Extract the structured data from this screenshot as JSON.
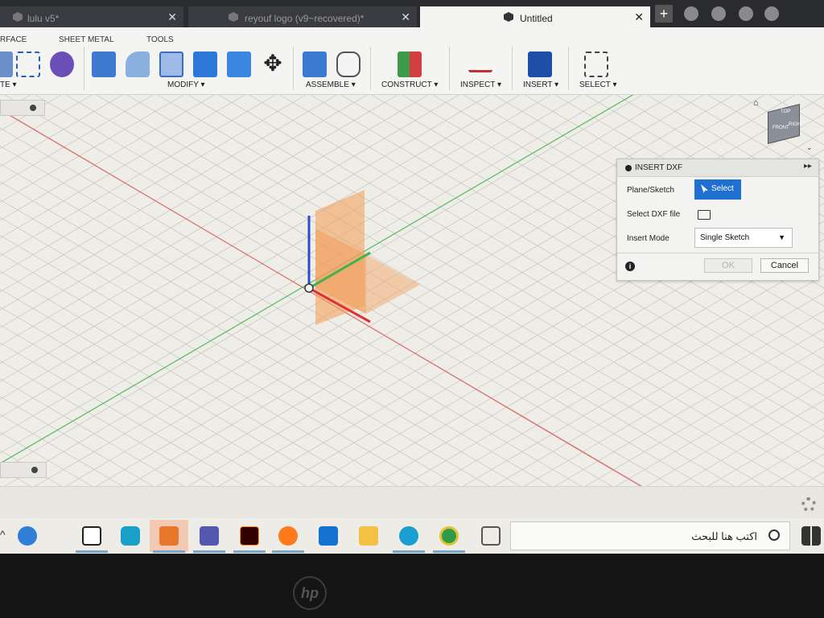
{
  "tabs": [
    {
      "label": "lulu v5*"
    },
    {
      "label": "reyouf logo (v9~recovered)*"
    },
    {
      "label": "Untitled"
    }
  ],
  "ribbon": {
    "tabs": [
      "RFACE",
      "SHEET METAL",
      "TOOLS"
    ],
    "groups": [
      "TE ▾",
      "MODIFY ▾",
      "ASSEMBLE ▾",
      "CONSTRUCT ▾",
      "INSPECT ▾",
      "INSERT ▾",
      "SELECT ▾"
    ]
  },
  "dialog": {
    "title": "INSERT DXF",
    "plane_label": "Plane/Sketch",
    "select_button": "Select",
    "file_label": "Select DXF file",
    "mode_label": "Insert Mode",
    "mode_value": "Single Sketch",
    "ok": "OK",
    "cancel": "Cancel"
  },
  "viewcube": {
    "faces": [
      "TOP",
      "FRONT",
      "RIGHT"
    ]
  },
  "taskbar": {
    "search_text": "اكتب هنا للبحث",
    "apps": [
      "task-view",
      "autodesk-a",
      "cortana",
      "fusion-360",
      "teams",
      "illustrator",
      "firefox",
      "mail",
      "file-explorer",
      "edge",
      "chrome",
      "taskview-2"
    ]
  },
  "colors": {
    "accent": "#1f6fd1",
    "plane": "#f0a060",
    "x_axis": "#e03030",
    "y_axis": "#3cb44b",
    "z_axis": "#2a4bd0"
  },
  "brand": "hp"
}
